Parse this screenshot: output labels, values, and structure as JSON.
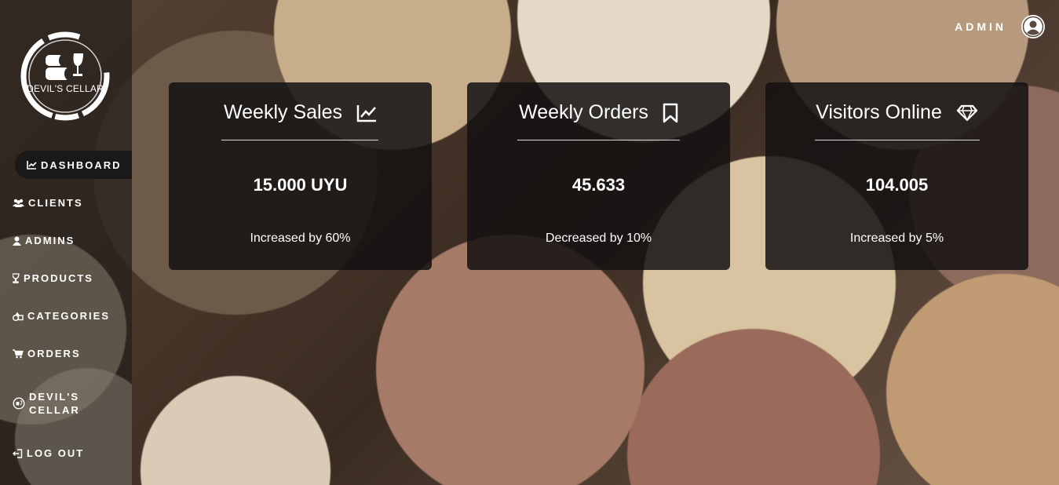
{
  "sidebar": {
    "logo_text": "DEVIL'S CELLAR",
    "items": [
      {
        "label": "DASHBOARD",
        "icon": "chart-line-icon",
        "active": true
      },
      {
        "label": "CLIENTS",
        "icon": "users-icon"
      },
      {
        "label": "ADMINS",
        "icon": "user-icon"
      },
      {
        "label": "PRODUCTS",
        "icon": "wine-glass-icon"
      },
      {
        "label": "CATEGORIES",
        "icon": "shapes-icon"
      },
      {
        "label": "ORDERS",
        "icon": "cart-icon"
      },
      {
        "label_line1": "DEVIL'S",
        "label_line2": "CELLAR",
        "icon": "brand-icon"
      },
      {
        "label": "LOG OUT",
        "icon": "logout-icon"
      }
    ]
  },
  "header": {
    "user_label": "ADMIN",
    "user_icon": "user-circle-icon"
  },
  "cards": [
    {
      "title": "Weekly Sales",
      "icon": "chart-line-icon",
      "value": "15.000 UYU",
      "change": "Increased by 60%"
    },
    {
      "title": "Weekly Orders",
      "icon": "bookmark-icon",
      "value": "45.633",
      "change": "Decreased by 10%"
    },
    {
      "title": "Visitors Online",
      "icon": "diamond-icon",
      "value": "104.005",
      "change": "Increased by 5%"
    }
  ],
  "colors": {
    "card_bg": "#141211",
    "active_nav_bg": "#1b1918",
    "text": "#ffffff"
  }
}
